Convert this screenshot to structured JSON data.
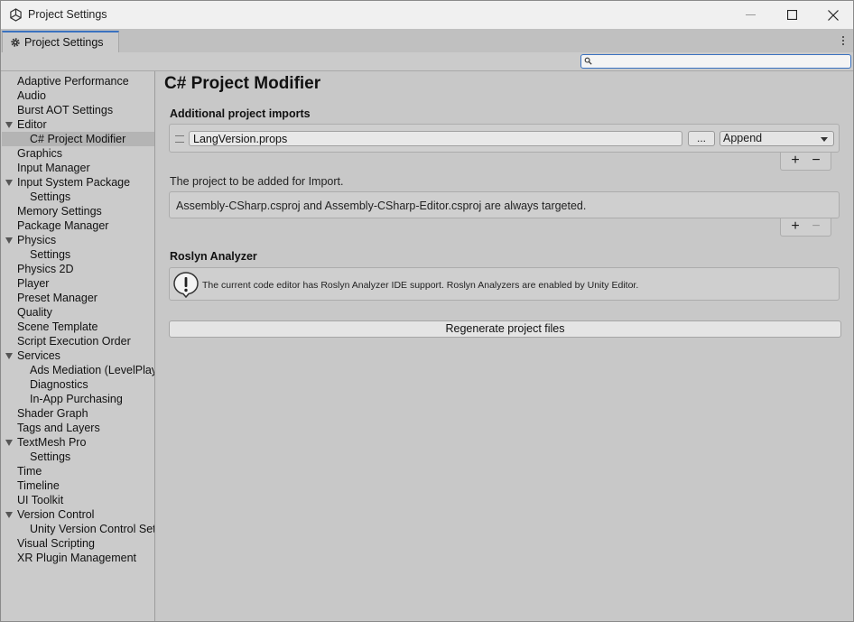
{
  "window": {
    "title": "Project Settings"
  },
  "tab": {
    "label": "Project Settings"
  },
  "search": {
    "value": "",
    "placeholder": ""
  },
  "sidebar": {
    "items": [
      {
        "label": "Adaptive Performance",
        "level": 0,
        "expandable": false
      },
      {
        "label": "Audio",
        "level": 0,
        "expandable": false
      },
      {
        "label": "Burst AOT Settings",
        "level": 0,
        "expandable": false
      },
      {
        "label": "Editor",
        "level": 0,
        "expandable": true
      },
      {
        "label": "C# Project Modifier",
        "level": 1,
        "expandable": false,
        "selected": true
      },
      {
        "label": "Graphics",
        "level": 0,
        "expandable": false
      },
      {
        "label": "Input Manager",
        "level": 0,
        "expandable": false
      },
      {
        "label": "Input System Package",
        "level": 0,
        "expandable": true
      },
      {
        "label": "Settings",
        "level": 1,
        "expandable": false
      },
      {
        "label": "Memory Settings",
        "level": 0,
        "expandable": false
      },
      {
        "label": "Package Manager",
        "level": 0,
        "expandable": false
      },
      {
        "label": "Physics",
        "level": 0,
        "expandable": true
      },
      {
        "label": "Settings",
        "level": 1,
        "expandable": false
      },
      {
        "label": "Physics 2D",
        "level": 0,
        "expandable": false
      },
      {
        "label": "Player",
        "level": 0,
        "expandable": false
      },
      {
        "label": "Preset Manager",
        "level": 0,
        "expandable": false
      },
      {
        "label": "Quality",
        "level": 0,
        "expandable": false
      },
      {
        "label": "Scene Template",
        "level": 0,
        "expandable": false
      },
      {
        "label": "Script Execution Order",
        "level": 0,
        "expandable": false
      },
      {
        "label": "Services",
        "level": 0,
        "expandable": true
      },
      {
        "label": "Ads Mediation (LevelPlay)",
        "level": 1,
        "expandable": false
      },
      {
        "label": "Diagnostics",
        "level": 1,
        "expandable": false
      },
      {
        "label": "In-App Purchasing",
        "level": 1,
        "expandable": false
      },
      {
        "label": "Shader Graph",
        "level": 0,
        "expandable": false
      },
      {
        "label": "Tags and Layers",
        "level": 0,
        "expandable": false
      },
      {
        "label": "TextMesh Pro",
        "level": 0,
        "expandable": true
      },
      {
        "label": "Settings",
        "level": 1,
        "expandable": false
      },
      {
        "label": "Time",
        "level": 0,
        "expandable": false
      },
      {
        "label": "Timeline",
        "level": 0,
        "expandable": false
      },
      {
        "label": "UI Toolkit",
        "level": 0,
        "expandable": false
      },
      {
        "label": "Version Control",
        "level": 0,
        "expandable": true
      },
      {
        "label": "Unity Version Control Settings",
        "level": 1,
        "expandable": false
      },
      {
        "label": "Visual Scripting",
        "level": 0,
        "expandable": false
      },
      {
        "label": "XR Plugin Management",
        "level": 0,
        "expandable": false
      }
    ]
  },
  "main": {
    "title": "C# Project Modifier",
    "imports": {
      "label": "Additional project imports",
      "entry_value": "LangVersion.props",
      "browse_label": "...",
      "mode": "Append",
      "add": "+",
      "remove": "−"
    },
    "targets": {
      "description": "The project to be added for Import.",
      "text": "Assembly-CSharp.csproj and Assembly-CSharp-Editor.csproj are always targeted.",
      "add": "+",
      "remove": "−"
    },
    "roslyn": {
      "label": "Roslyn Analyzer",
      "message": "The current code editor has Roslyn Analyzer IDE support. Roslyn Analyzers are enabled by Unity Editor."
    },
    "regenerate_label": "Regenerate project files"
  }
}
